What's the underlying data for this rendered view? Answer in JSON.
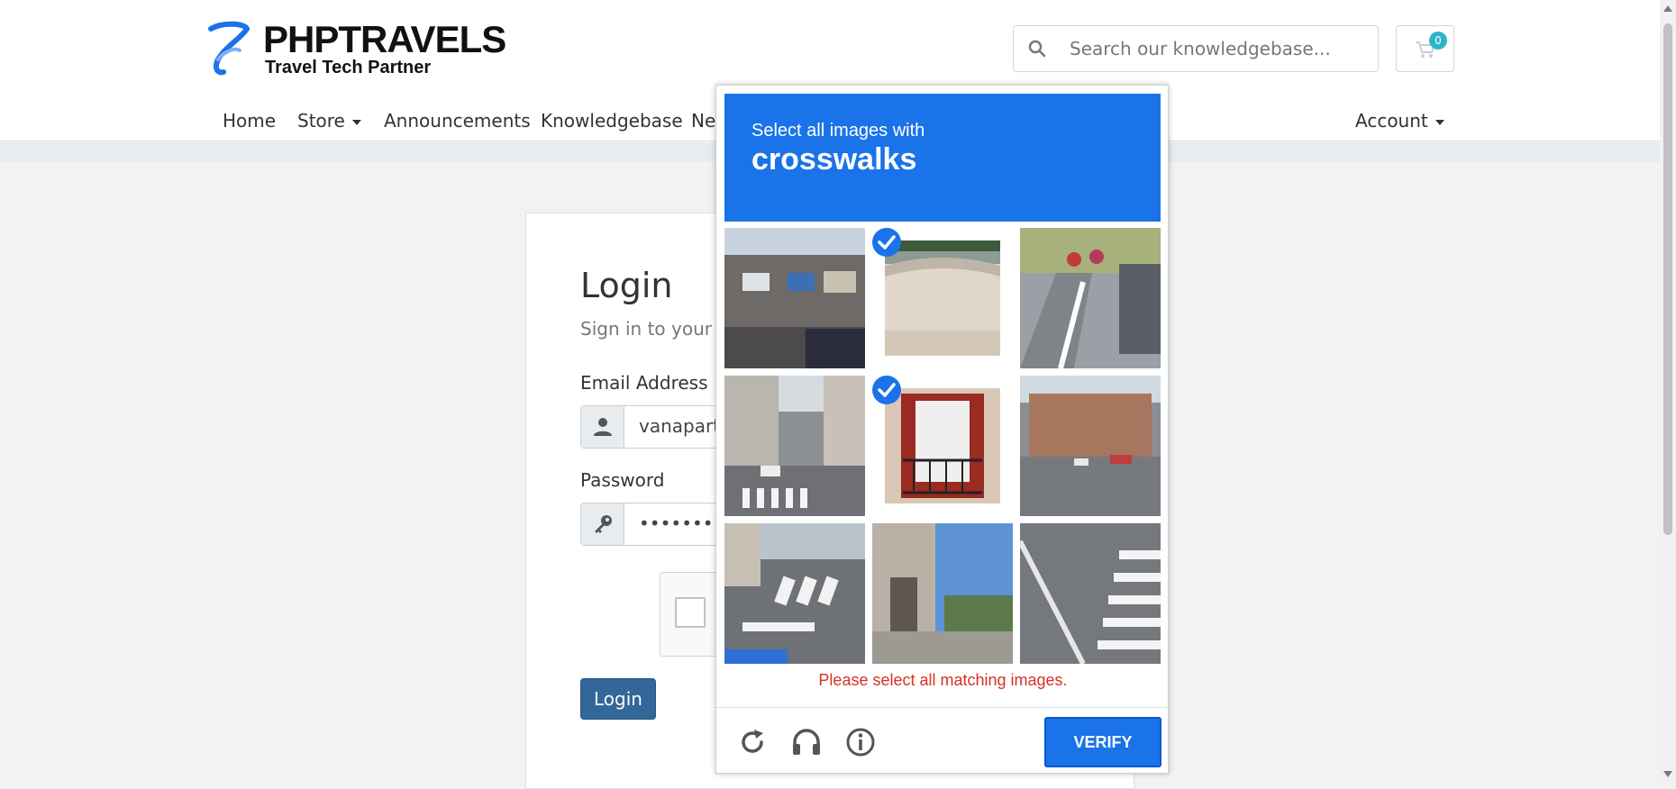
{
  "brand": {
    "title": "PHPTRAVELS",
    "tagline": "Travel Tech Partner"
  },
  "search": {
    "placeholder": "Search our knowledgebase..."
  },
  "cart": {
    "count": "0"
  },
  "nav": {
    "items": [
      "Home",
      "Store",
      "Announcements",
      "Knowledgebase",
      "Ne"
    ],
    "account": "Account"
  },
  "login": {
    "title": "Login",
    "subtitle": "Sign in to your a",
    "email_label": "Email Address",
    "email_value": "vanapart",
    "password_label": "Password",
    "password_value": "••••••••",
    "button": "Login"
  },
  "captcha": {
    "prompt": "Select all images with",
    "target": "crosswalks",
    "error": "Please select all matching images.",
    "verify": "VERIFY",
    "tiles": [
      {
        "scene": "building-street",
        "selected": false
      },
      {
        "scene": "bridge-closeup",
        "selected": true
      },
      {
        "scene": "cyclists-road",
        "selected": false
      },
      {
        "scene": "city-crosswalk",
        "selected": false
      },
      {
        "scene": "balcony-door",
        "selected": true
      },
      {
        "scene": "intersection",
        "selected": false
      },
      {
        "scene": "road-crosswalk",
        "selected": false
      },
      {
        "scene": "house-street",
        "selected": false
      },
      {
        "scene": "zebra-crossing",
        "selected": false
      }
    ]
  },
  "colors": {
    "captcha_blue": "#1a73e8",
    "login_button": "#336699",
    "error_red": "#d93025",
    "badge": "#2cb5c9"
  }
}
